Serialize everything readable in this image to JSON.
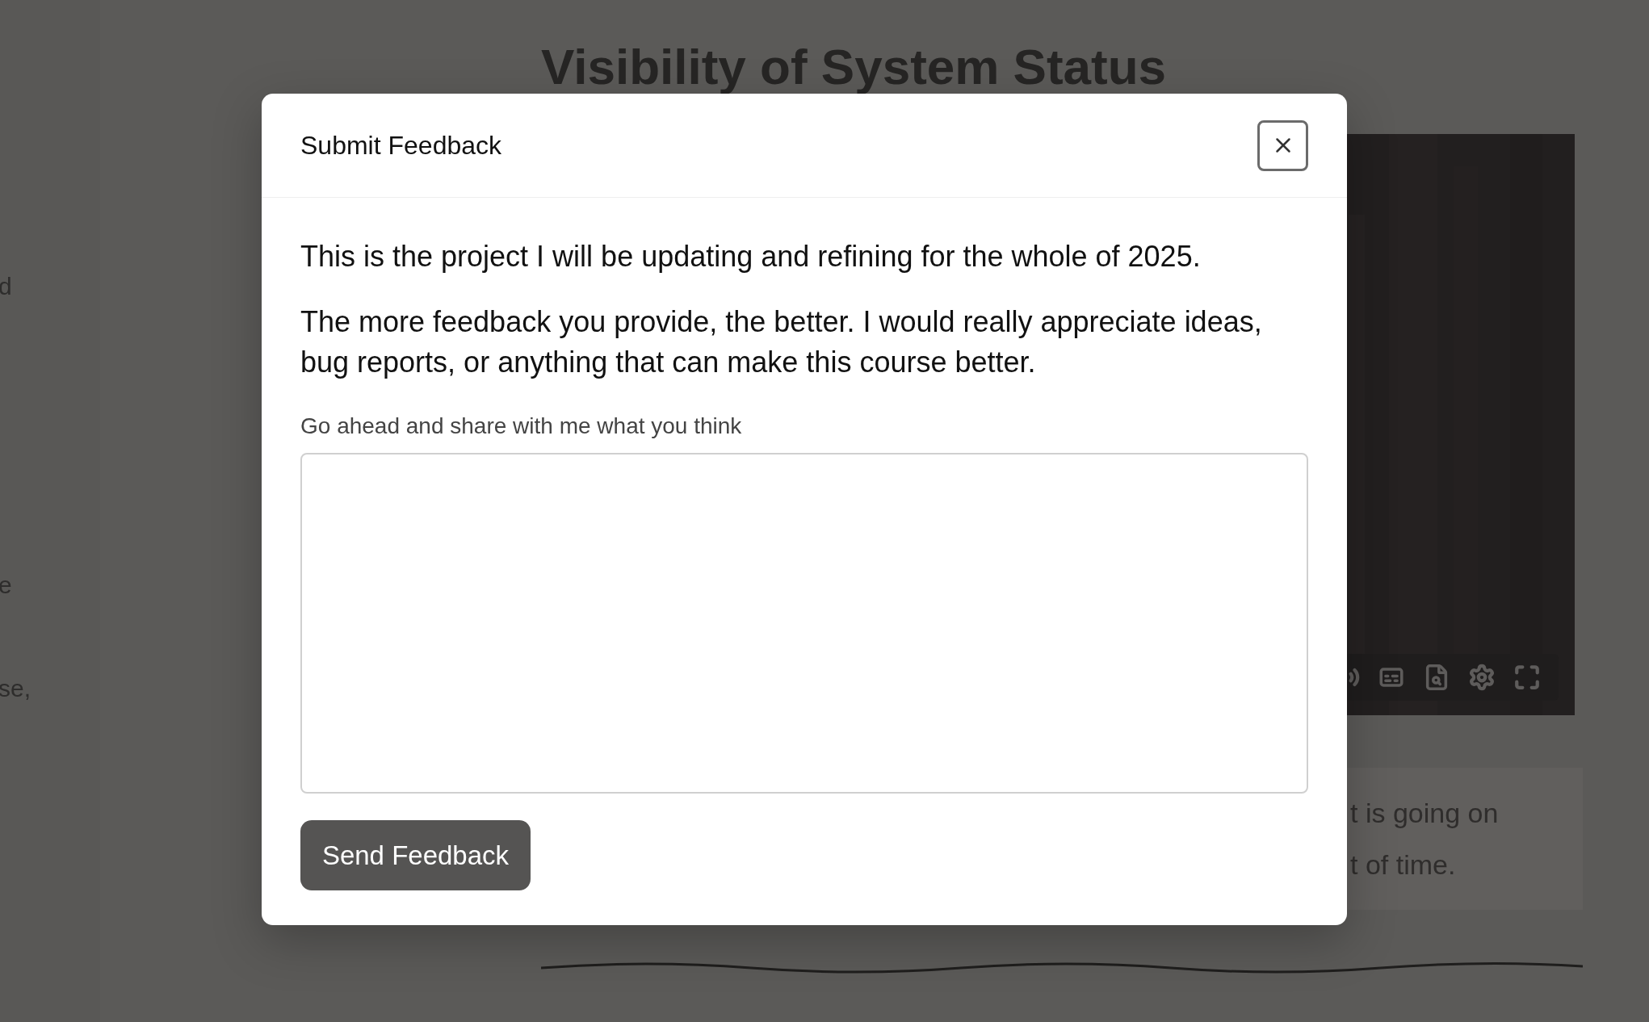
{
  "page": {
    "title": "Visibility of System Status",
    "left_fragments": [
      "d",
      "e",
      "se,"
    ],
    "callout_lines": [
      "t is going on",
      "t of time."
    ]
  },
  "modal": {
    "title": "Submit Feedback",
    "paragraphs": [
      "This is the project I will be updating and refining for the whole of 2025.",
      "The more feedback you provide, the better. I would really appreciate ideas, bug reports, or anything that can make this course better."
    ],
    "field": {
      "label": "Go ahead and share with me what you think"
    },
    "button": "Send Feedback"
  }
}
